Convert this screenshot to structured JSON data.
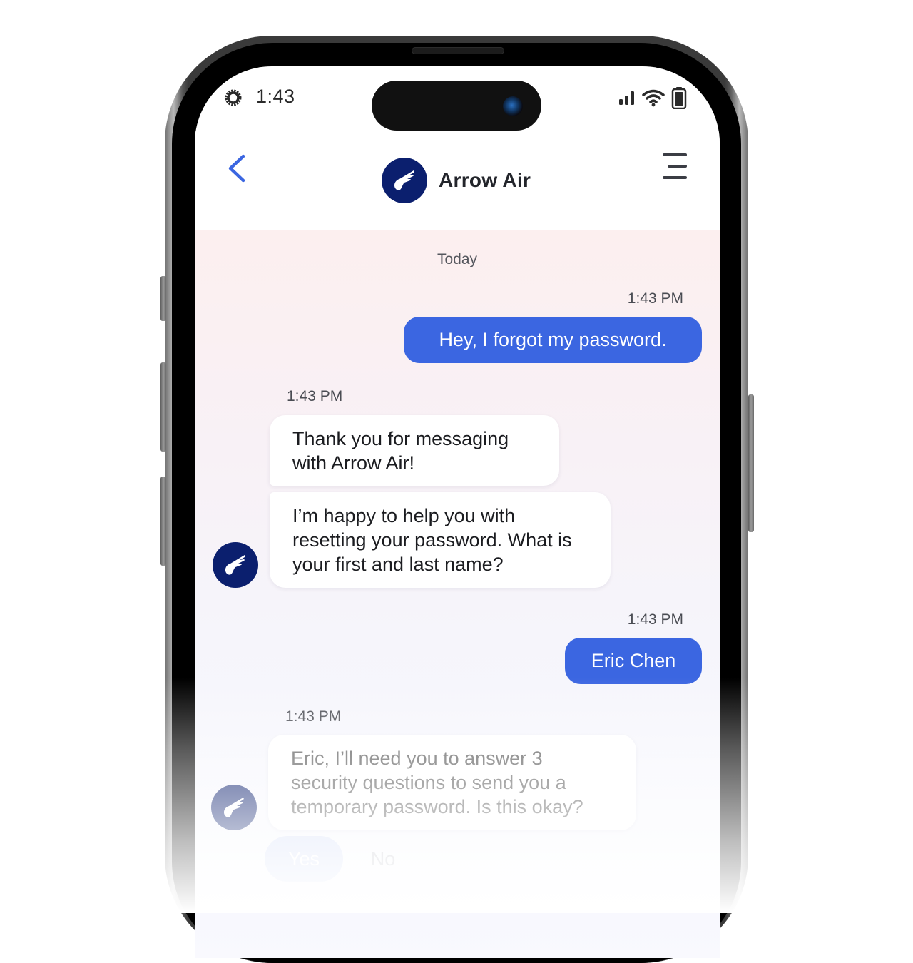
{
  "status_bar": {
    "time": "1:43",
    "left_icon": "gear-icon",
    "right_icons": [
      "signal-icon",
      "wifi-icon",
      "battery-icon"
    ]
  },
  "header": {
    "back_icon": "chevron-left-icon",
    "brand_name": "Arrow Air",
    "brand_logo": "wing-logo-icon",
    "menu_icon": "menu-icon"
  },
  "chat": {
    "day_separator": "Today",
    "messages": [
      {
        "sender": "user",
        "time": "1:43 PM",
        "text": "Hey, I forgot my password."
      },
      {
        "sender": "bot",
        "time": "1:43 PM",
        "bubbles": [
          "Thank you for messaging with Arrow Air!",
          "I’m happy to help you with resetting your password. What is your first and last name?"
        ]
      },
      {
        "sender": "user",
        "time": "1:43 PM",
        "text": "Eric Chen"
      },
      {
        "sender": "bot",
        "time": "1:43 PM",
        "bubbles": [
          "Eric, I’ll need you to answer 3 security questions to send you a temporary password. Is this okay?"
        ]
      }
    ],
    "quick_replies": [
      "Yes",
      "No"
    ]
  },
  "colors": {
    "brand_navy": "#0b1f6e",
    "user_bubble": "#3b66e1",
    "back_chevron": "#3b66e1",
    "quick_reply_yes": "#cfd9f6"
  }
}
